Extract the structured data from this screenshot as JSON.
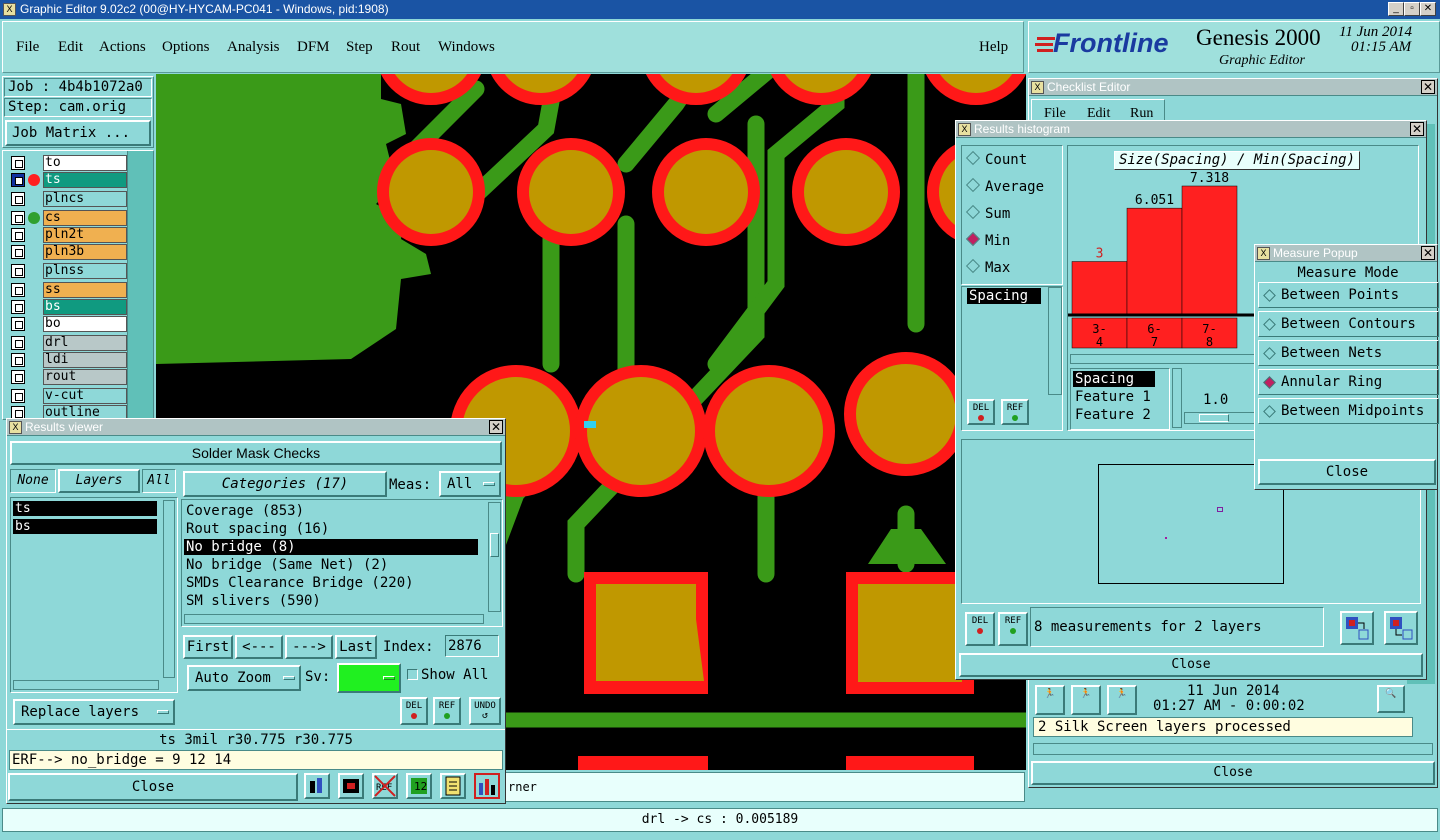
{
  "app": {
    "title": "Graphic Editor 9.02c2 (00@HY-HYCAM-PC041 - Windows, pid:1908)",
    "icon": "x-app-icon"
  },
  "menu": {
    "items": [
      "File",
      "Edit",
      "Actions",
      "Options",
      "Analysis",
      "DFM",
      "Step",
      "Rout",
      "Windows"
    ],
    "help": "Help"
  },
  "brand": {
    "logo": "Frontline",
    "product": "Genesis 2000",
    "subtitle": "Graphic Editor",
    "date": "11 Jun 2014",
    "time": "01:15 AM"
  },
  "job": {
    "job_label": "Job : 4b4b1072a0",
    "step_label": "Step: cam.orig",
    "matrix_button": "Job Matrix ..."
  },
  "layers": [
    {
      "name": "to",
      "color": "#ffffff",
      "dot": ""
    },
    {
      "name": "ts",
      "color": "#109a80",
      "dot": "#ff2020",
      "sel": true
    },
    {
      "name": "plncs",
      "color": "#8ed8d8",
      "dot": ""
    },
    {
      "name": "cs",
      "color": "#f0b050",
      "dot": "#30a030"
    },
    {
      "name": "pln2t",
      "color": "#f0b050",
      "dot": ""
    },
    {
      "name": "pln3b",
      "color": "#f0b050",
      "dot": ""
    },
    {
      "name": "plnss",
      "color": "#8ed8d8",
      "dot": ""
    },
    {
      "name": "ss",
      "color": "#f0b050",
      "dot": ""
    },
    {
      "name": "bs",
      "color": "#109a80",
      "dot": ""
    },
    {
      "name": "bo",
      "color": "#ffffff",
      "dot": ""
    },
    {
      "name": "drl",
      "color": "#b8c8c8",
      "dot": ""
    },
    {
      "name": "ldi",
      "color": "#b8c8c8",
      "dot": ""
    },
    {
      "name": "rout",
      "color": "#b8c8c8",
      "dot": ""
    },
    {
      "name": "v-cut",
      "color": "#8ed8d8",
      "dot": ""
    },
    {
      "name": "outline",
      "color": "#8ed8d8",
      "dot": ""
    }
  ],
  "results_viewer": {
    "title": "Results viewer",
    "header": "Solder Mask Checks",
    "tabs": {
      "none": "None",
      "layers": "Layers",
      "all": "All"
    },
    "layer_list": [
      "ts",
      "bs"
    ],
    "categories_label": "Categories (17)",
    "meas_label": "Meas:",
    "meas_value": "All",
    "categories": [
      "Coverage (853)",
      "Rout spacing (16)",
      "No bridge (8)",
      "No bridge (Same Net) (2)",
      "SMDs Clearance Bridge (220)",
      "SM slivers (590)"
    ],
    "selected_category": 2,
    "nav": {
      "first": "First",
      "prev": "<---",
      "next": "--->",
      "last": "Last",
      "index_label": "Index:",
      "index_value": "2876"
    },
    "auto_zoom": "Auto Zoom",
    "sv_label": "Sv:",
    "show_all": "Show All",
    "replace_layers": "Replace layers",
    "small_btns": {
      "del": "DEL",
      "ref": "REF",
      "undo": "UNDO"
    },
    "info": "ts 3mil  r30.775  r30.775",
    "erf": "ERF--> no_bridge = 9 12 14",
    "close": "Close"
  },
  "histogram": {
    "title": "Results histogram",
    "radios": [
      "Count",
      "Average",
      "Sum",
      "Min",
      "Max"
    ],
    "selected_radio": "Min",
    "list": [
      "Spacing"
    ],
    "chart_title": "Size(Spacing) / Min(Spacing)",
    "fields": [
      "Spacing",
      "Feature 1",
      "Feature 2"
    ],
    "slider_value": "1.0",
    "status": "8 measurements for 2 layers",
    "close": "Close"
  },
  "chart_data": {
    "type": "bar",
    "title": "Size(Spacing) / Min(Spacing)",
    "categories": [
      "3-\n4",
      "6-\n7",
      "7-\n8"
    ],
    "cat_top": [
      "3-",
      "6-",
      "7-"
    ],
    "cat_bottom": [
      "4",
      "7",
      "8"
    ],
    "values": [
      3,
      6.051,
      7.318
    ],
    "labels": [
      "3",
      "6.051",
      "7.318"
    ],
    "bar_color": "#ff2020"
  },
  "checklist": {
    "title": "Checklist Editor",
    "menu": [
      "File",
      "Edit",
      "Run"
    ],
    "date": "11 Jun 2014",
    "time": "01:27 AM - 0:00:02",
    "message": "2 Silk Screen layers processed",
    "close": "Close"
  },
  "measure": {
    "title": "Measure Popup",
    "header": "Measure Mode",
    "modes": [
      "Between Points",
      "Between Contours",
      "Between Nets",
      "Annular Ring",
      "Between Midpoints"
    ],
    "selected": "Annular Ring",
    "close": "Close"
  },
  "hidden_text": {
    "corner": "rner"
  },
  "status": "drl -> cs : 0.005189"
}
